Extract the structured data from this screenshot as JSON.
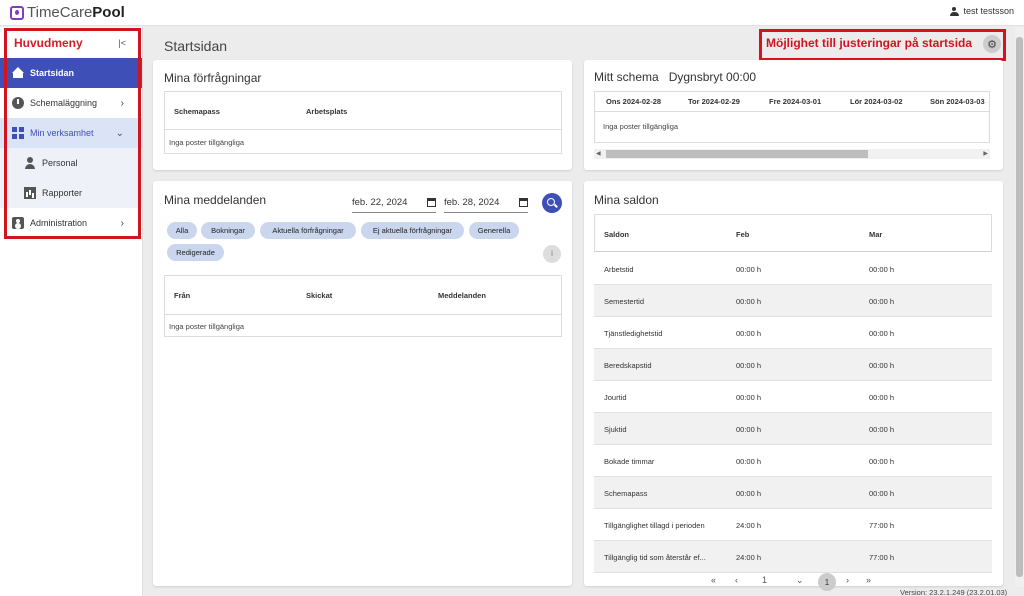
{
  "app": {
    "logo_time": "TimeCare",
    "logo_pool": "Pool",
    "user_name": "test testsson",
    "version": "Version: 23.2.1.249 (23.2.01.03)"
  },
  "sidebar": {
    "title": "Huvudmeny",
    "collapse_icon": "|<",
    "items": [
      {
        "label": "Startsidan",
        "icon": "home-icon"
      },
      {
        "label": "Schemaläggning",
        "icon": "clock-icon"
      },
      {
        "label": "Min verksamhet",
        "icon": "dashboard-icon"
      },
      {
        "label": "Personal",
        "icon": "person-icon"
      },
      {
        "label": "Rapporter",
        "icon": "report-icon"
      },
      {
        "label": "Administration",
        "icon": "admin-icon"
      }
    ]
  },
  "header": {
    "title": "Startsidan",
    "settings_note": "Möjlighet till justeringar på startsida"
  },
  "requests": {
    "title": "Mina förfrågningar",
    "columns": [
      "Schemapass",
      "Arbetsplats"
    ],
    "empty": "Inga poster tillgängliga"
  },
  "messages": {
    "title": "Mina meddelanden",
    "date_from": "feb. 22, 2024",
    "date_to": "feb. 28, 2024",
    "filters": [
      "Alla",
      "Bokningar",
      "Aktuella förfrågningar",
      "Ej aktuella förfrågningar",
      "Generella",
      "Redigerade"
    ],
    "columns": [
      "Från",
      "Skickat",
      "Meddelanden"
    ],
    "empty": "Inga poster tillgängliga"
  },
  "schedule": {
    "title": "Mitt schema",
    "subtitle": "Dygnsbryt 00:00",
    "days": [
      "Ons 2024-02-28",
      "Tor 2024-02-29",
      "Fre 2024-03-01",
      "Lör 2024-03-02",
      "Sön 2024-03-03"
    ],
    "empty": "Inga poster tillgängliga"
  },
  "saldon": {
    "title": "Mina saldon",
    "columns": [
      "Saldon",
      "Feb",
      "Mar"
    ],
    "rows": [
      [
        "Arbetstid",
        "00:00 h",
        "00:00 h"
      ],
      [
        "Semestertid",
        "00:00 h",
        "00:00 h"
      ],
      [
        "Tjänstledighetstid",
        "00:00 h",
        "00:00 h"
      ],
      [
        "Beredskapstid",
        "00:00 h",
        "00:00 h"
      ],
      [
        "Jourtid",
        "00:00 h",
        "00:00 h"
      ],
      [
        "Sjuktid",
        "00:00 h",
        "00:00 h"
      ],
      [
        "Bokade timmar",
        "00:00 h",
        "00:00 h"
      ],
      [
        "Schemapass",
        "00:00 h",
        "00:00 h"
      ],
      [
        "Tillgänglighet tillagd i perioden",
        "24:00 h",
        "77:00 h"
      ],
      [
        "Tillgänglig tid som återstår ef...",
        "24:00 h",
        "77:00 h"
      ]
    ],
    "page": "1",
    "page_current": "1"
  }
}
